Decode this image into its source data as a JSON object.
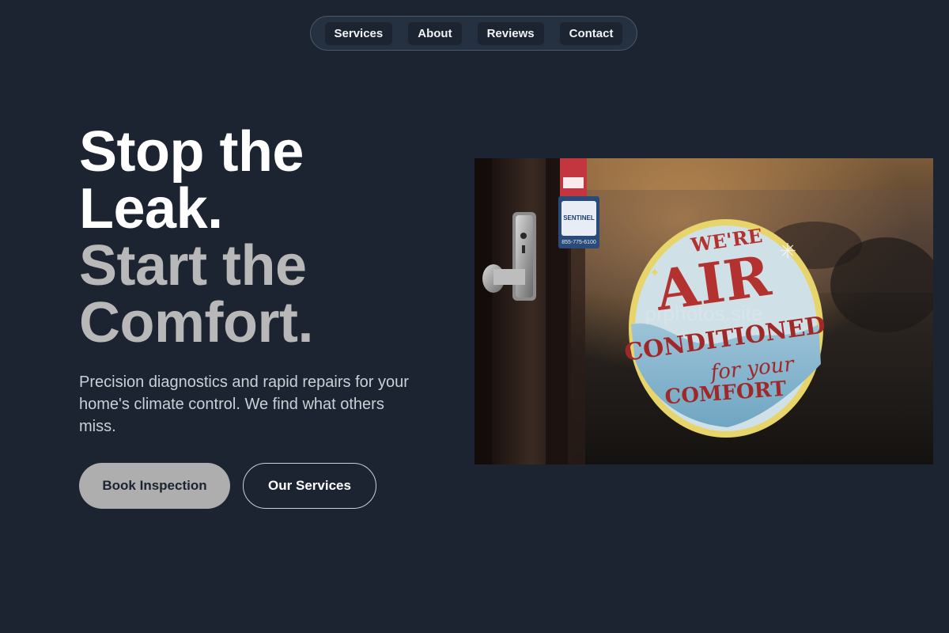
{
  "nav": {
    "items": [
      {
        "label": "Services"
      },
      {
        "label": "About"
      },
      {
        "label": "Reviews"
      },
      {
        "label": "Contact"
      }
    ]
  },
  "hero": {
    "headline_line1": "Stop the",
    "headline_line2": "Leak.",
    "headline_line3": "Start the",
    "headline_line4": "Comfort.",
    "subtext": "Precision diagnostics and rapid repairs for your home's climate control. We find what others miss.",
    "primary_button": "Book Inspection",
    "secondary_button": "Our Services"
  },
  "image": {
    "sign_line1": "WE'RE",
    "sign_line2": "AIR",
    "sign_line3": "CONDITIONED",
    "sign_line4": "for your",
    "sign_line5": "COMFORT",
    "sticker_brand": "SENTINEL",
    "sticker_phone": "855-775-6100",
    "watermark": "prphotos.site"
  },
  "colors": {
    "background": "#1b2430",
    "nav_background": "#253140",
    "headline_white": "#ffffff",
    "headline_grey": "#b8b8b8",
    "primary_button": "#aeaeae"
  }
}
